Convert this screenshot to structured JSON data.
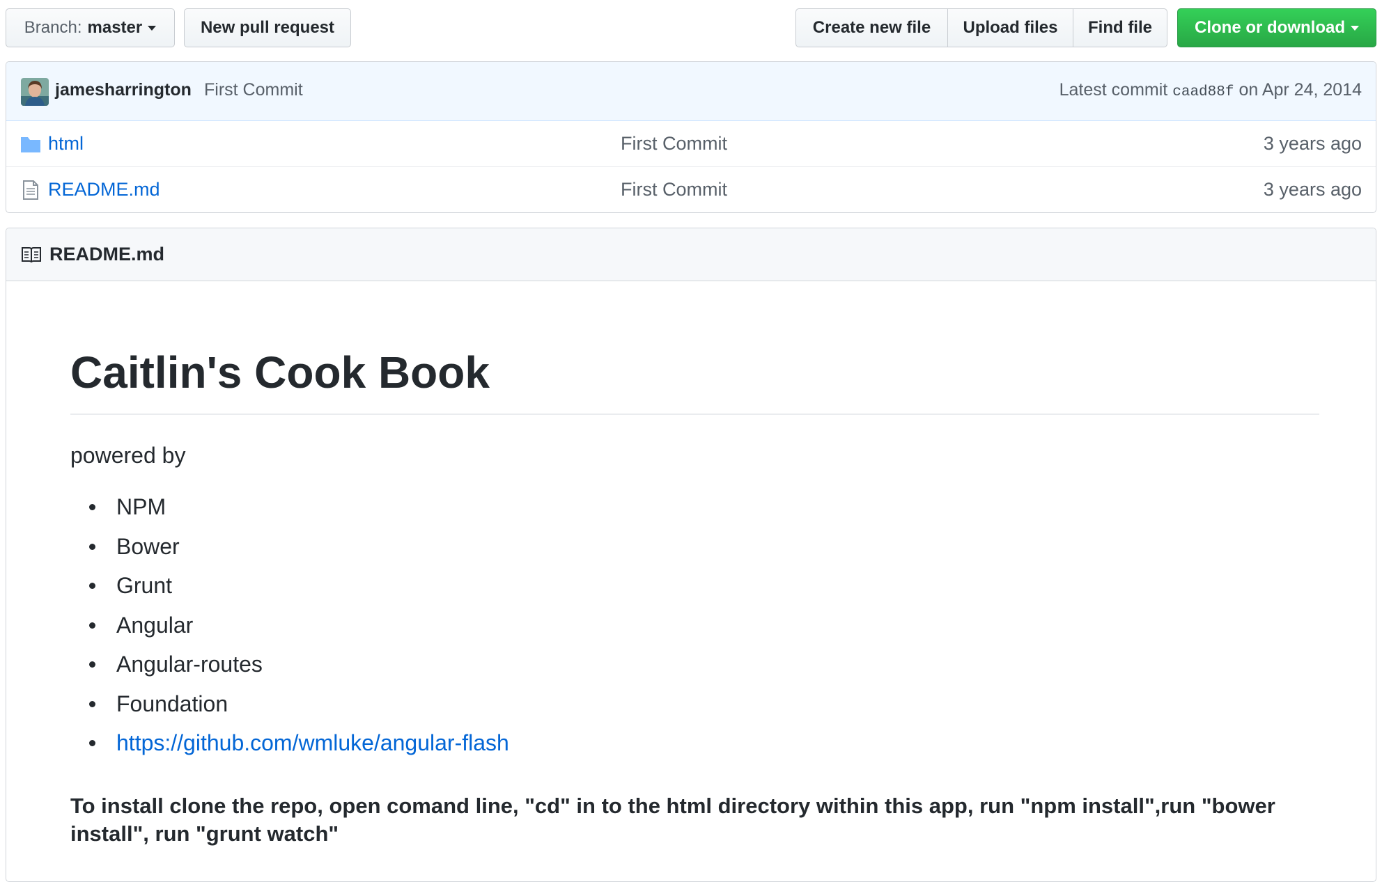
{
  "toolbar": {
    "branch_prefix": "Branch:",
    "branch_name": "master",
    "new_pr_label": "New pull request",
    "create_file_label": "Create new file",
    "upload_label": "Upload files",
    "find_label": "Find file",
    "clone_label": "Clone or download"
  },
  "commit": {
    "author": "jamesharrington",
    "message": "First Commit",
    "latest_prefix": "Latest commit",
    "sha": "caad88f",
    "date": "on Apr 24, 2014"
  },
  "files": [
    {
      "name": "html",
      "icon": "folder-icon",
      "commit": "First Commit",
      "age": "3 years ago"
    },
    {
      "name": "README.md",
      "icon": "file-icon",
      "commit": "First Commit",
      "age": "3 years ago"
    }
  ],
  "readme": {
    "header": "README.md",
    "title": "Caitlin's Cook Book",
    "intro": "powered by",
    "items": [
      "NPM",
      "Bower",
      "Grunt",
      "Angular",
      "Angular-routes",
      "Foundation",
      "https://github.com/wmluke/angular-flash"
    ],
    "install": "To install clone the repo, open comand line, \"cd\" in to the html directory within this app, run \"npm install\",run \"bower install\", run \"grunt watch\""
  },
  "colors": {
    "link": "#0366d6",
    "clone_button": "#28a745",
    "commit_bar": "#f1f8ff",
    "folder_icon": "#79b8ff"
  }
}
